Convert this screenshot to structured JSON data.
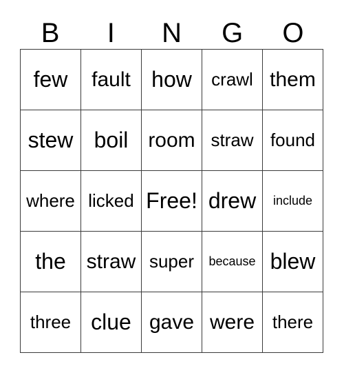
{
  "card": {
    "title": "BINGO",
    "headers": [
      "B",
      "I",
      "N",
      "G",
      "O"
    ],
    "grid_border_color": "#3a3a3a",
    "background_color": "#ffffff",
    "text_color": "#000000",
    "rows": [
      [
        {
          "text": "few",
          "size": "size-lg"
        },
        {
          "text": "fault",
          "size": "size-md"
        },
        {
          "text": "how",
          "size": "size-lg"
        },
        {
          "text": "crawl",
          "size": "size-sm"
        },
        {
          "text": "them",
          "size": "size-md"
        }
      ],
      [
        {
          "text": "stew",
          "size": "size-lg"
        },
        {
          "text": "boil",
          "size": "size-lg"
        },
        {
          "text": "room",
          "size": "size-md"
        },
        {
          "text": "straw",
          "size": "size-sm"
        },
        {
          "text": "found",
          "size": "size-sm"
        }
      ],
      [
        {
          "text": "where",
          "size": "size-sm"
        },
        {
          "text": "licked",
          "size": "size-sm"
        },
        {
          "text": "Free!",
          "size": "size-free"
        },
        {
          "text": "drew",
          "size": "size-lg"
        },
        {
          "text": "include",
          "size": "size-xs"
        }
      ],
      [
        {
          "text": "the",
          "size": "size-lg"
        },
        {
          "text": "straw",
          "size": "size-md"
        },
        {
          "text": "super",
          "size": "size-sm"
        },
        {
          "text": "because",
          "size": "size-xs"
        },
        {
          "text": "blew",
          "size": "size-lg"
        }
      ],
      [
        {
          "text": "three",
          "size": "size-sm"
        },
        {
          "text": "clue",
          "size": "size-lg"
        },
        {
          "text": "gave",
          "size": "size-md"
        },
        {
          "text": "were",
          "size": "size-md"
        },
        {
          "text": "there",
          "size": "size-sm"
        }
      ]
    ]
  }
}
